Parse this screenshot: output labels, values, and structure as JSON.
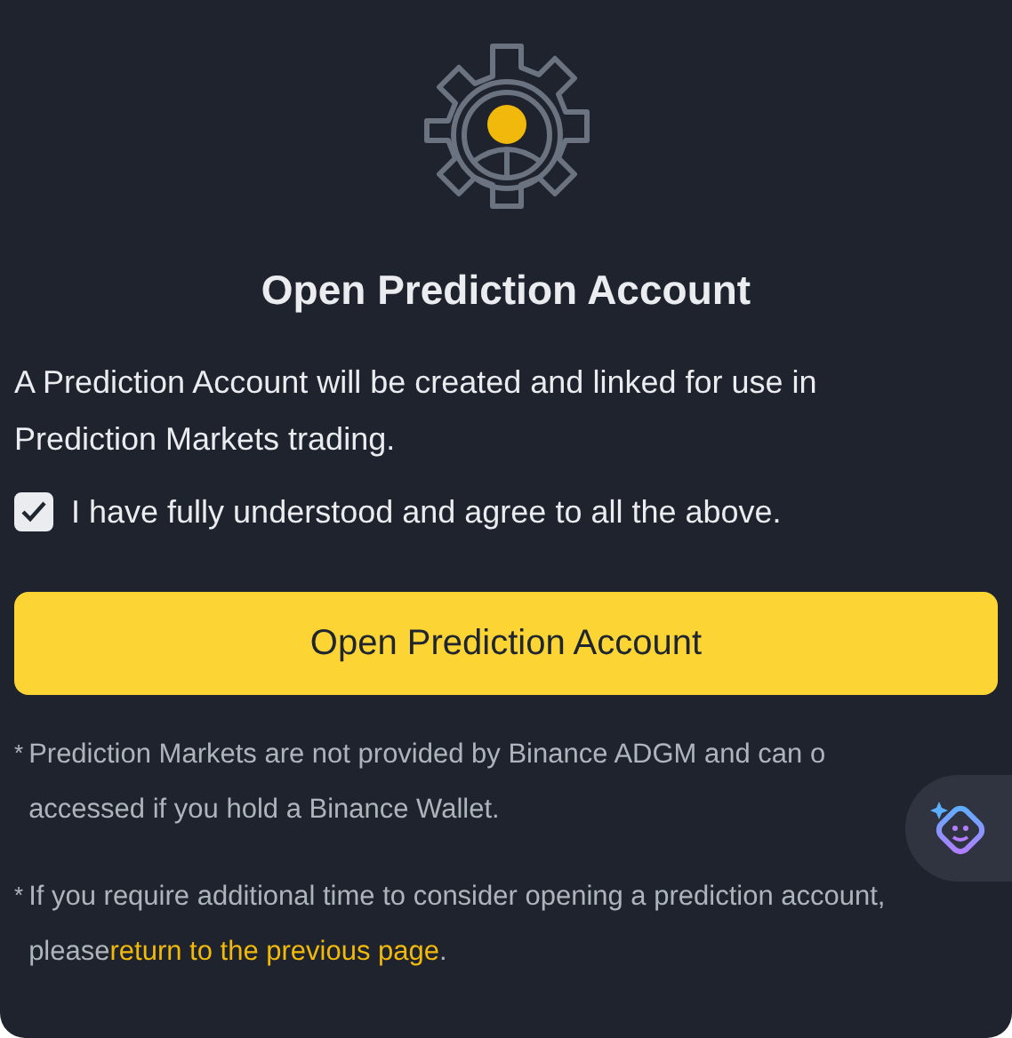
{
  "title": "Open Prediction Account",
  "description": "A Prediction Account will be created and linked for use in Prediction Markets trading.",
  "agreement": {
    "label": "I have fully understood and agree to all the above.",
    "checked": true
  },
  "button": "Open Prediction Account",
  "notes": [
    {
      "marker": "*",
      "lines": [
        "Prediction Markets are not provided by Binance ADGM and can o",
        "accessed if you hold a Binance Wallet."
      ]
    },
    {
      "marker": "*",
      "text": "If you require additional time to consider opening a prediction account, please",
      "link": "return to the previous page",
      "after": "."
    }
  ]
}
